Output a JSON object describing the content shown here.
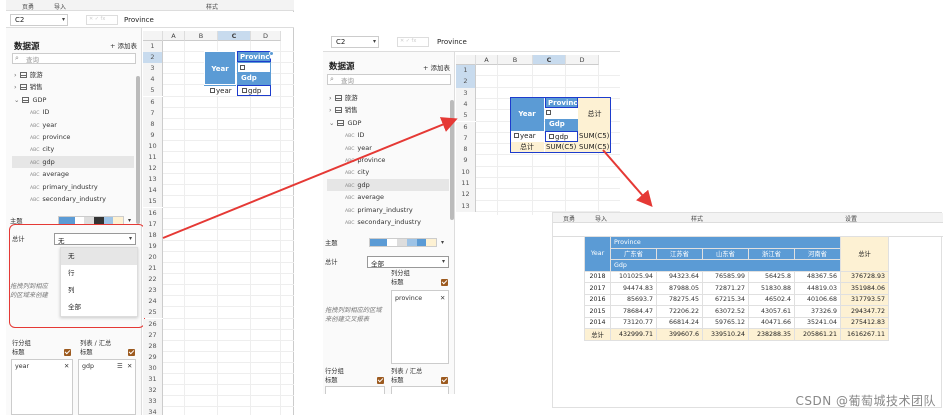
{
  "left": {
    "toolbar": {
      "tab1": "页勇",
      "tab2": "导入",
      "tab3": "样式"
    },
    "cell_ref": "C2",
    "formula": "Province",
    "datasource_title": "数据源",
    "add_table": "+ 添加表",
    "search_placeholder": "查询",
    "tree": [
      {
        "type": "table",
        "label": "旅游"
      },
      {
        "type": "table",
        "label": "销售"
      },
      {
        "type": "table-open",
        "label": "GDP"
      },
      {
        "type": "field",
        "label": "ID"
      },
      {
        "type": "field",
        "label": "year"
      },
      {
        "type": "field",
        "label": "province"
      },
      {
        "type": "field",
        "label": "city"
      },
      {
        "type": "field",
        "label": "gdp"
      },
      {
        "type": "field",
        "label": "average"
      },
      {
        "type": "field",
        "label": "primary_industry"
      },
      {
        "type": "field",
        "label": "secondary_industry"
      }
    ],
    "theme_label": "主题",
    "total_label": "总计",
    "total_value": "无",
    "menu": [
      "无",
      "行",
      "列",
      "全部"
    ],
    "hint": "拖拽列到相应的区域来创建交叉报表",
    "row_group_label": "行分组",
    "row_group_sub": "标题",
    "col_label": "列表 / 汇总",
    "col_sub": "标题",
    "row_chip": "year",
    "col_chip": "gdp",
    "columns": [
      "A",
      "B",
      "C",
      "D"
    ],
    "rows": [
      "1",
      "2",
      "3",
      "4",
      "5",
      "6",
      "7",
      "8",
      "9",
      "10",
      "11",
      "12",
      "13",
      "14",
      "15",
      "16",
      "17",
      "18",
      "19",
      "20",
      "21",
      "22",
      "23",
      "24",
      "25",
      "26",
      "27",
      "28",
      "29",
      "30",
      "31",
      "32",
      "33",
      "34"
    ],
    "pivot": {
      "year": "Year",
      "province": "Province",
      "field_province": "province",
      "gdp": "Gdp",
      "field_year": "year",
      "field_gdp": "gdp"
    }
  },
  "right": {
    "cell_ref": "C2",
    "formula": "Province",
    "datasource_title": "数据源",
    "add_table": "+ 添加表",
    "search_placeholder": "查询",
    "tree": [
      {
        "type": "table",
        "label": "旅游"
      },
      {
        "type": "table",
        "label": "销售"
      },
      {
        "type": "table-open",
        "label": "GDP"
      },
      {
        "type": "field",
        "label": "ID"
      },
      {
        "type": "field",
        "label": "year"
      },
      {
        "type": "field",
        "label": "province"
      },
      {
        "type": "field",
        "label": "city"
      },
      {
        "type": "field",
        "label": "gdp"
      },
      {
        "type": "field",
        "label": "average"
      },
      {
        "type": "field",
        "label": "primary_industry"
      },
      {
        "type": "field",
        "label": "secondary_industry"
      }
    ],
    "theme_label": "主题",
    "total_label": "总计",
    "total_value": "全部",
    "col_group_label": "列分组",
    "col_group_sub": "标题",
    "col_chip": "province",
    "hint": "拖拽列到相应的区域来创建交叉报表",
    "row_group_label": "行分组",
    "row_group_sub": "标题",
    "list_label": "列表 / 汇总",
    "list_sub": "标题",
    "columns": [
      "A",
      "B",
      "C",
      "D"
    ],
    "rows": [
      "1",
      "2",
      "3",
      "4",
      "5",
      "6",
      "7",
      "8",
      "9",
      "10",
      "11",
      "12",
      "13"
    ],
    "pivot": {
      "year": "Year",
      "province": "Province",
      "field_province": "province",
      "gdp": "Gdp",
      "total": "总计",
      "field_year": "year",
      "field_gdp": "gdp",
      "sum1": "SUM(C5)",
      "sum2": "SUM(C5)",
      "total2": "总计"
    }
  },
  "result": {
    "toolbar": {
      "tab1": "页勇",
      "tab2": "导入",
      "tab3": "样式",
      "tab4": "设置"
    },
    "year_header": "Year",
    "province_header": "Province",
    "total_header": "总计",
    "gdp_header": "Gdp",
    "provinces": [
      "广东省",
      "江苏省",
      "山东省",
      "浙江省",
      "河南省"
    ],
    "rows": [
      {
        "year": "2018",
        "v": [
          "101025.94",
          "94323.64",
          "76585.99",
          "56425.8",
          "48367.56"
        ],
        "t": "376728.93"
      },
      {
        "year": "2017",
        "v": [
          "94474.83",
          "87988.05",
          "72871.27",
          "51830.88",
          "44819.03"
        ],
        "t": "351984.06"
      },
      {
        "year": "2016",
        "v": [
          "85693.7",
          "78275.45",
          "67215.34",
          "46502.4",
          "40106.68"
        ],
        "t": "317793.57"
      },
      {
        "year": "2015",
        "v": [
          "78684.47",
          "72206.22",
          "63072.52",
          "43057.61",
          "37326.9"
        ],
        "t": "294347.72"
      },
      {
        "year": "2014",
        "v": [
          "73120.77",
          "66814.24",
          "59765.12",
          "40471.66",
          "35241.04"
        ],
        "t": "275412.83"
      }
    ],
    "total_row": {
      "label": "总计",
      "v": [
        "432999.71",
        "399607.6",
        "339510.24",
        "238288.35",
        "205861.21"
      ],
      "t": "1616267.11"
    }
  },
  "watermark": "CSDN @葡萄城技术团队",
  "colors": {
    "header_blue": "#5b9bd5",
    "total_bg": "#fdf1d3",
    "arrow_red": "#e53935",
    "selection": "#1d3ccd"
  }
}
